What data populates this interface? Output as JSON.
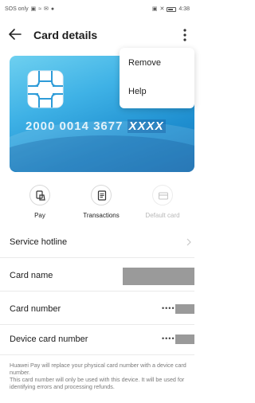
{
  "status_bar": {
    "left_text": "SOS only",
    "time": "4:38"
  },
  "header": {
    "title": "Card details"
  },
  "card": {
    "number_visible": "2000 0014 3677",
    "number_masked": "XXXX",
    "colors": {
      "top": "#6ed0f0",
      "bottom": "#1678bd"
    }
  },
  "menu": {
    "items": [
      {
        "label": "Remove"
      },
      {
        "label": "Help"
      }
    ]
  },
  "actions": [
    {
      "label": "Pay",
      "icon": "pay-icon",
      "enabled": true
    },
    {
      "label": "Transactions",
      "icon": "transactions-icon",
      "enabled": true
    },
    {
      "label": "Default card",
      "icon": "default-card-icon",
      "enabled": false
    }
  ],
  "rows": {
    "service_hotline": {
      "label": "Service hotline"
    },
    "card_name": {
      "label": "Card name"
    },
    "card_number": {
      "label": "Card number",
      "value_prefix": "••••"
    },
    "device_card_number": {
      "label": "Device card number",
      "value_prefix": "••••"
    }
  },
  "footnote": "Huawei Pay will replace your physical card number with a device card number.\nThis card number will only be used with this device. It will be used for identifying errors and processing refunds."
}
